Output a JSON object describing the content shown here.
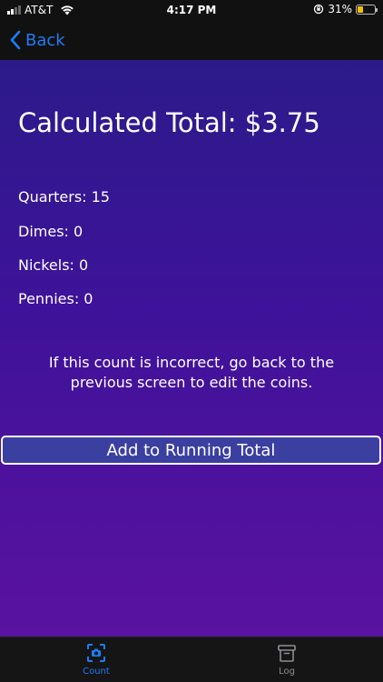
{
  "status": {
    "carrier": "AT&T",
    "time": "4:17 PM",
    "battery_pct": "31%",
    "battery_level": 0.31
  },
  "nav": {
    "back_label": "Back"
  },
  "main": {
    "title": "Calculated Total: $3.75",
    "coins": [
      {
        "label": "Quarters: 15"
      },
      {
        "label": "Dimes: 0"
      },
      {
        "label": "Nickels: 0"
      },
      {
        "label": "Pennies: 0"
      }
    ],
    "note": "If this count is incorrect, go back to the previous screen to edit the coins.",
    "add_button": "Add to Running Total"
  },
  "tabs": [
    {
      "label": "Count",
      "icon": "camera-scan-icon",
      "active": true
    },
    {
      "label": "Log",
      "icon": "archive-box-icon",
      "active": false
    }
  ],
  "colors": {
    "accent": "#1e7cf5",
    "gradient_top": "#2c1a8a",
    "gradient_bottom": "#5a12a0",
    "button_fill": "#3a3fa0",
    "battery": "#f5c400"
  }
}
